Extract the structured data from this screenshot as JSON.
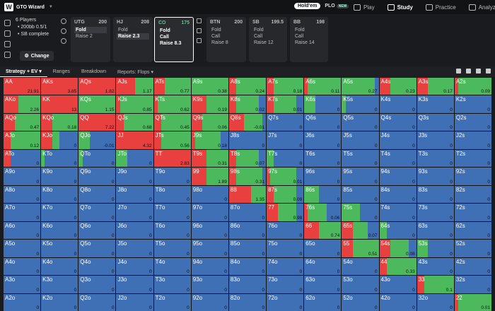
{
  "app": {
    "title": "GTO Wizard",
    "logo_letter": "W"
  },
  "mode": {
    "holdem": "Hold'em",
    "plo": "PLO",
    "new_badge": "NEW"
  },
  "nav": [
    {
      "label": "Play",
      "icon": "play-icon"
    },
    {
      "label": "Study",
      "icon": "study-icon",
      "active": true
    },
    {
      "label": "Practice",
      "icon": "practice-icon"
    },
    {
      "label": "Analyze",
      "icon": "analyze-icon"
    }
  ],
  "game": {
    "players": "6 Players",
    "stakes": "200bb 0.5/1",
    "sb": "SB complete",
    "change_label": "Change"
  },
  "positions": [
    {
      "name": "UTG",
      "stack": "200",
      "actions": [
        "Fold",
        "Raise 2"
      ],
      "selected": "Fold"
    },
    {
      "name": "HJ",
      "stack": "208",
      "actions": [
        "Fold",
        "Raise 2.3"
      ],
      "selected": "Raise 2.3"
    },
    {
      "name": "CO",
      "stack": "175",
      "actions": [
        "Fold",
        "Call",
        "Raise 8.3"
      ],
      "active": true
    },
    {
      "name": "BTN",
      "stack": "200",
      "actions": [
        "Fold",
        "Call",
        "Raise 8"
      ]
    },
    {
      "name": "SB",
      "stack": "199.5",
      "actions": [
        "Fold",
        "Call",
        "Raise 12"
      ]
    },
    {
      "name": "BB",
      "stack": "198",
      "actions": [
        "Fold",
        "Call",
        "Raise 14"
      ]
    }
  ],
  "tabs": [
    "Strategy + EV",
    "Ranges",
    "Breakdown",
    "Reports: Flops"
  ],
  "colors": {
    "raise": "#e8403f",
    "call": "#4cba5c",
    "fold": "#3f6fb5"
  },
  "matrix": [
    [
      "AA|1|0|21.91",
      "AKs|1|0|3.85",
      "AQs|1|0|1.82",
      "AJs|0.5|0.5|1.17",
      "ATs|0.3|0.7|0.77",
      "A9s|0|1|0.38",
      "A8s|0.2|0.8|0.24",
      "A7s|0.2|0.8|0.18",
      "A6s|0.1|0.9|0.11",
      "A5s|0|0.9|0.27",
      "A4s|0.3|0.7|0.23",
      "A3s|0.3|0.7|0.17",
      "A2s|0.1|0.9|0.09"
    ],
    [
      "AKo|0.4|0.6|2.26",
      "KK|1|0|13",
      "KQs|0|1|1.15",
      "KJs|0.1|0.9|0.85",
      "KTs|0.1|0.9|0.62",
      "K9s|0.4|0.6|0.19",
      "K8s|0.2|0.6|0.02",
      "K7s|0.2|0.6|0.01",
      "K6s|0|0.3|0",
      "K5s|0|0.1|0",
      "K4s|0|0|0",
      "K3s|0|0|0",
      "K2s|0|0|0"
    ],
    [
      "AQo|0.3|0.7|0.47",
      "KQo|0.3|0.7|0.18",
      "QQ|1|0|7.22",
      "QJs|0.2|0.8|0.68",
      "QTs|0.2|0.8|0.45",
      "Q9s|0.3|0.7|0.06",
      "Q8s|0.4|0.5|-0.01",
      "Q7s|0|0|0",
      "Q6s|0|0|0",
      "Q5s|0|0|0",
      "Q4s|0|0|0",
      "Q3s|0|0|0",
      "Q2s|0|0|0"
    ],
    [
      "AJo|0.2|0.8|0.12",
      "KJo|0.3|0.2|0",
      "QJo|0|0.3|-0.01",
      "JJ|1|0|4.32",
      "JTs|0.2|0.8|0.56",
      "J9s|0.1|0.7|0.18",
      "J8s|0|0|0",
      "J7s|0|0|0",
      "J6s|0|0|0",
      "J5s|0|0|0",
      "J4s|0|0|0",
      "J3s|0|0|0",
      "J2s|0|0|0"
    ],
    [
      "ATo|0.2|0|0",
      "KTo|0|0.1|0",
      "QTo|0|0.1|0",
      "JTo|0|0.3|0",
      "TT|1|0|2.83",
      "T9s|0.4|0.6|0.31",
      "T8s|0.2|0.6|0.07",
      "T7s|0|0.2|0",
      "T6s|0|0|0",
      "T5s|0|0|0",
      "T4s|0|0|0",
      "T3s|0|0|0",
      "T2s|0|0|0"
    ],
    [
      "A9o|0|0|0",
      "K9o|0|0|0",
      "Q9o|0|0|0",
      "J9o|0|0|0",
      "T9o|0|0|0",
      "99|0.4|0.6|1.89",
      "98s|0.2|0.7|0.31",
      "97s|0.1|0.7|0.01",
      "96s|0|0|0",
      "95s|0|0|0",
      "94s|0|0|0",
      "93s|0|0|0",
      "92s|0|0|0"
    ],
    [
      "A8o|0|0|0",
      "K8o|0|0|0",
      "Q8o|0|0|0",
      "J8o|0|0|0",
      "T8o|0|0|0",
      "98o|0|0|0",
      "88|0.6|0.4|1.35",
      "87s|0.2|0.6|0.09",
      "86s|0|0.4|0",
      "85s|0|0|0",
      "84s|0|0|0",
      "83s|0|0|0",
      "82s|0|0|0"
    ],
    [
      "A7o|0|0|0",
      "K7o|0|0|0",
      "Q7o|0|0|0",
      "J7o|0|0|0",
      "T7o|0|0|0",
      "97o|0|0|0",
      "87o|0|0|0",
      "77|0.3|0.5|0.98",
      "76s|0.1|0.5|0.06",
      "75s|0|0.5|0",
      "74s|0|0|0",
      "73s|0|0|0",
      "72s|0|0|0"
    ],
    [
      "A6o|0|0|0",
      "K6o|0|0|0",
      "Q6o|0|0|0",
      "J6o|0|0|0",
      "T6o|0|0|0",
      "96o|0|0|0",
      "86o|0|0|0",
      "76o|0|0|0",
      "66|0.4|0.6|0.74",
      "65s|0.3|0.4|0.07",
      "64s|0|0.2|0",
      "63s|0|0|0",
      "62s|0|0|0"
    ],
    [
      "A5o|0|0|0",
      "K5o|0|0|0",
      "Q5o|0|0|0",
      "J5o|0|0|0",
      "T5o|0|0|0",
      "95o|0|0|0",
      "85o|0|0|0",
      "75o|0|0|0",
      "65o|0|0|0",
      "55|0.3|0.7|0.51",
      "54s|0.3|0.5|0.08",
      "53s|0|0.3|0",
      "52s|0|0|0"
    ],
    [
      "A4o|0|0|0",
      "K4o|0|0|0",
      "Q4o|0|0|0",
      "J4o|0|0|0",
      "T4o|0|0|0",
      "94o|0|0|0",
      "84o|0|0|0",
      "74o|0|0|0",
      "64o|0|0|0",
      "54o|0|0|0",
      "44|0.2|0.8|0.33",
      "43s|0|0|0",
      "42s|0|0|0"
    ],
    [
      "A3o|0|0|0",
      "K3o|0|0|0",
      "Q3o|0|0|0",
      "J3o|0|0|0",
      "T3o|0|0|0",
      "93o|0|0|0",
      "83o|0|0|0",
      "73o|0|0|0",
      "63o|0|0|0",
      "53o|0|0|0",
      "43o|0|0|0",
      "33|0.2|0.8|0.1",
      "32s|0|0|0"
    ],
    [
      "A2o|0|0|0",
      "K2o|0|0|0",
      "Q2o|0|0|0",
      "J2o|0|0|0",
      "T2o|0|0|0",
      "92o|0|0|0",
      "82o|0|0|0",
      "72o|0|0|0",
      "62o|0|0|0",
      "52o|0|0|0",
      "42o|0|0|0",
      "32o|0|0|0",
      "22|0.1|0.9|0.01"
    ]
  ]
}
